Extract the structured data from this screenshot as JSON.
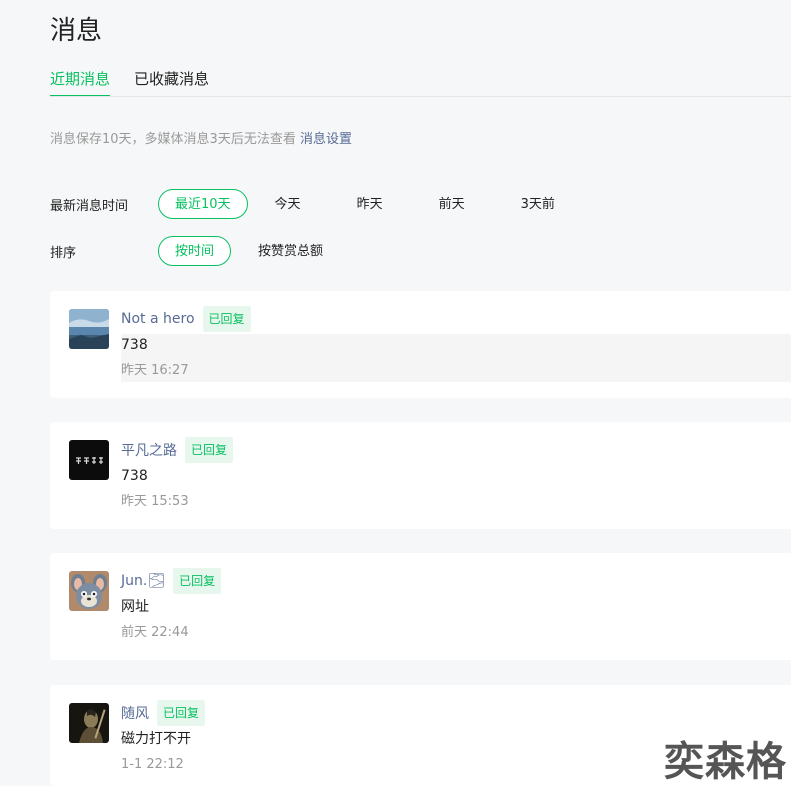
{
  "page": {
    "title": "消息"
  },
  "tabs": [
    {
      "label": "近期消息",
      "active": true
    },
    {
      "label": "已收藏消息",
      "active": false
    }
  ],
  "notice": {
    "text": "消息保存10天，多媒体消息3天后无法查看 ",
    "link": "消息设置"
  },
  "filters": {
    "time_label": "最新消息时间",
    "time_options": [
      "最近10天",
      "今天",
      "昨天",
      "前天",
      "3天前"
    ],
    "time_selected": "最近10天",
    "sort_label": "排序",
    "sort_options": [
      "按时间",
      "按赞赏总额"
    ],
    "sort_selected": "按时间"
  },
  "messages": [
    {
      "nickname": "Not a hero",
      "badge": "已回复",
      "content": "738",
      "time": "昨天 16:27",
      "avatar_icon": "sky-landscape-avatar"
    },
    {
      "nickname": "平凡之路",
      "badge": "已回复",
      "content": "738",
      "time": "昨天 15:53",
      "avatar_icon": "dark-text-avatar"
    },
    {
      "nickname": "Jun.🌫",
      "badge": "已回复",
      "content": "网址",
      "time": "前天 22:44",
      "avatar_icon": "cartoon-cat-avatar"
    },
    {
      "nickname": "随风",
      "badge": "已回复",
      "content": "磁力打不开",
      "time": "1-1 22:12",
      "avatar_icon": "dark-figure-avatar"
    }
  ],
  "watermark": "奕森格",
  "colors": {
    "accent": "#07c160",
    "link": "#576b95",
    "muted": "#999999",
    "badge_bg": "#e8f7ee"
  }
}
